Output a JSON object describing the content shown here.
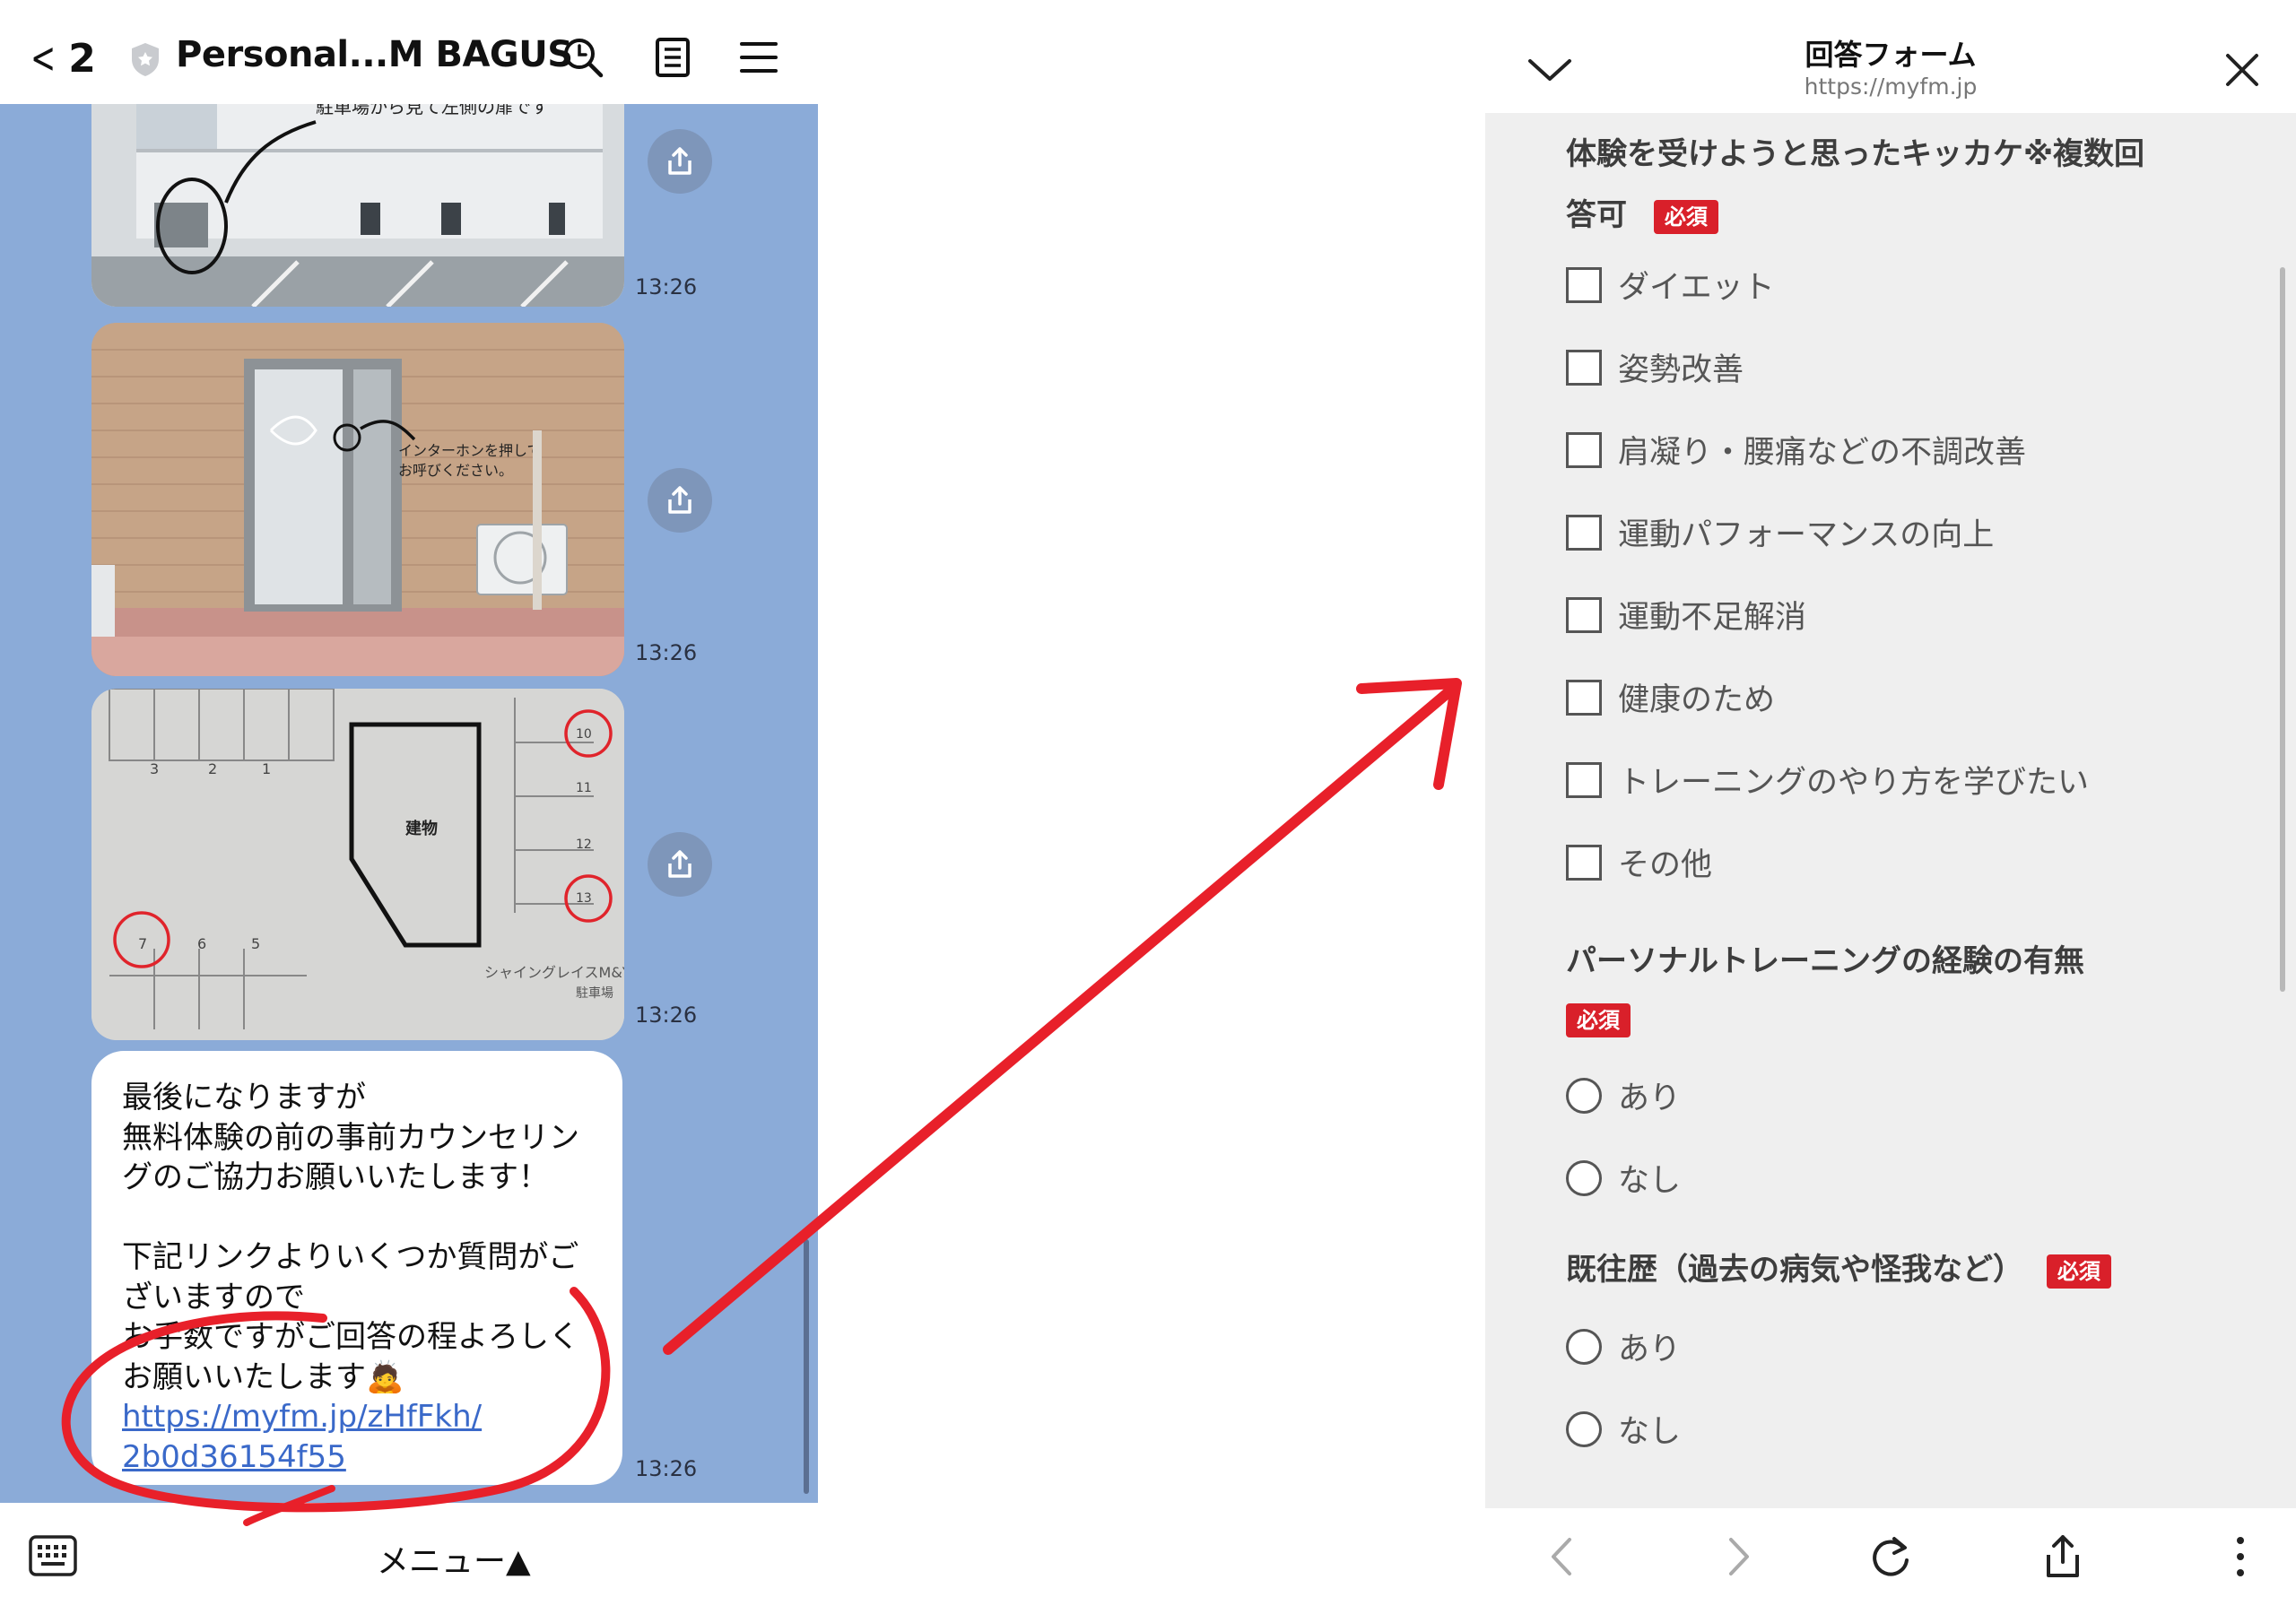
{
  "chat": {
    "back_count": "2",
    "title": "Personal...M BAGUS",
    "photos": [
      {
        "caption": "駐車場から見て左側の扉です",
        "time": "13:26"
      },
      {
        "caption_line1": "インターホンを押して",
        "caption_line2": "お呼びください。",
        "time": "13:26"
      },
      {
        "building_label": "建物",
        "spaces": [
          "3",
          "2",
          "1",
          "10",
          "11",
          "12",
          "13",
          "7",
          "6",
          "5"
        ],
        "lot_name": "シャイングレイスM&Y",
        "lot_sub": "駐車場",
        "time": "13:26"
      }
    ],
    "message": {
      "lines": [
        "最後になりますが",
        "無料体験の前の事前カウンセリン",
        "グのご協力お願いいたします！",
        "",
        "下記リンクよりいくつか質問がご",
        "ざいますので",
        "お手数ですがご回答の程よろしく",
        "お願いいたします🙇"
      ],
      "link_line1": "https://myfm.jp/zHfFkh/",
      "link_line2": "2b0d36154f55",
      "time": "13:26"
    },
    "footer_menu": "メニュー▲"
  },
  "browser": {
    "title": "回答フォーム",
    "url": "https://myfm.jp",
    "required_badge": "必須",
    "q1": {
      "title_line1": "体験を受けようと思ったキッカケ※複数回",
      "title_line2": "答可",
      "options": [
        "ダイエット",
        "姿勢改善",
        "肩凝り・腰痛などの不調改善",
        "運動パフォーマンスの向上",
        "運動不足解消",
        "健康のため",
        "トレーニングのやり方を学びたい",
        "その他"
      ]
    },
    "q2": {
      "title": "パーソナルトレーニングの経験の有無",
      "options": [
        "あり",
        "なし"
      ]
    },
    "q3": {
      "title": "既往歴（過去の病気や怪我など）",
      "options": [
        "あり",
        "なし"
      ]
    }
  },
  "colors": {
    "chat_bg": "#8babd8",
    "link": "#3a69c9",
    "required": "#d9202a",
    "annotation": "#e8202a"
  },
  "icons": [
    "chevron-left-icon",
    "shield-icon",
    "search-icon",
    "note-icon",
    "hamburger-icon",
    "share-icon",
    "keyboard-icon",
    "chevron-down-icon",
    "close-icon",
    "back-arrow-icon",
    "forward-arrow-icon",
    "reload-icon",
    "share-icon",
    "more-vertical-icon"
  ]
}
